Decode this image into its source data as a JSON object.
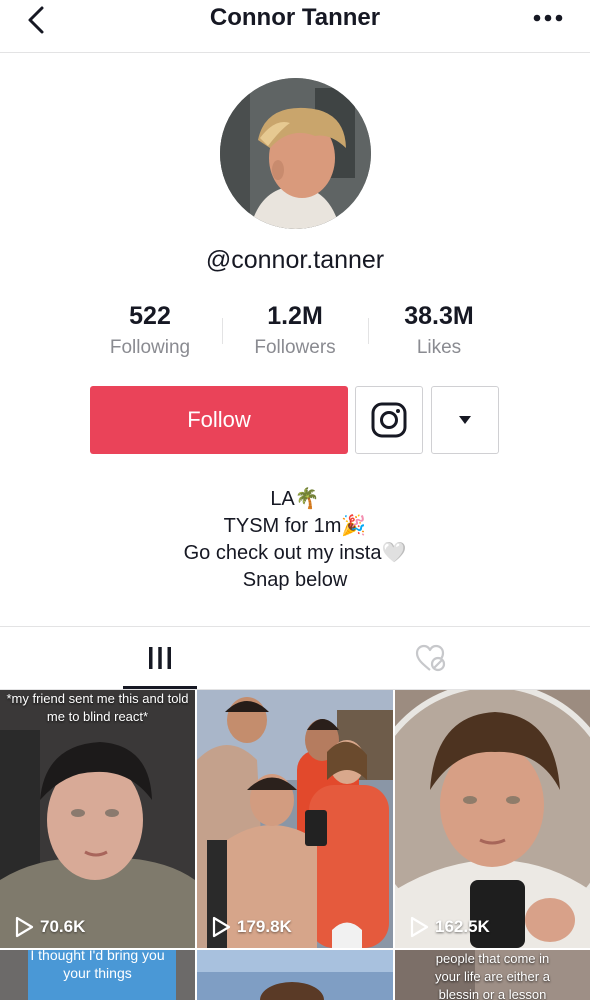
{
  "header": {
    "title": "Connor Tanner",
    "back_icon": "chevron-left-icon",
    "more_icon": "more-horizontal-icon"
  },
  "profile": {
    "username": "@connor.tanner",
    "stats": [
      {
        "value": "522",
        "label": "Following"
      },
      {
        "value": "1.2M",
        "label": "Followers"
      },
      {
        "value": "38.3M",
        "label": "Likes"
      }
    ],
    "follow_label": "Follow",
    "bio": [
      "LA🌴",
      "TYSM for 1m🎉",
      "Go check out my insta🤍",
      "Snap below"
    ]
  },
  "tabs": [
    {
      "name": "videos",
      "icon": "grid-icon",
      "active": true
    },
    {
      "name": "liked",
      "icon": "liked-hidden-icon",
      "active": false
    }
  ],
  "videos": [
    {
      "views": "70.6K",
      "caption": "*my friend sent me this and told me to blind react*"
    },
    {
      "views": "179.8K",
      "caption": ""
    },
    {
      "views": "162.5K",
      "caption": ""
    },
    {
      "views": "",
      "caption": "I thought I'd bring you your things"
    },
    {
      "views": "",
      "caption": ""
    },
    {
      "views": "",
      "caption": "people that come in your life are either a blessin or a lesson"
    }
  ],
  "colors": {
    "accent": "#ea4359",
    "text": "#161823",
    "muted": "#8a8b91",
    "border": "#e3e3e4"
  }
}
